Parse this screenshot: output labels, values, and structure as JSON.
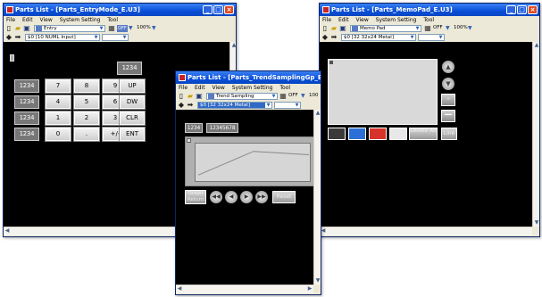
{
  "window_left": {
    "title": "Parts List - [Parts_EntryMode_E.U3]",
    "menu": [
      "File",
      "Edit",
      "View",
      "System Setting",
      "Tool"
    ],
    "toolbar": {
      "part_select": "Entry",
      "toggle": "OFF",
      "zoom": "100%"
    },
    "address_field": "$0 [10 NUML Input]",
    "display_label": "1234",
    "readouts": [
      "1234",
      "1234",
      "1234",
      "1234"
    ],
    "keys": [
      "7",
      "8",
      "9",
      "UP",
      "4",
      "5",
      "6",
      "DW",
      "1",
      "2",
      "3",
      "CLR",
      "0",
      ".",
      "+/-",
      "ENT"
    ]
  },
  "window_middle": {
    "title": "Parts List - [Parts_TrendSamplingGp_E.U3]",
    "menu": [
      "File",
      "Edit",
      "View",
      "System Setting",
      "Tool"
    ],
    "toolbar": {
      "part_select": "Trend Sampling",
      "toggle": "OFF",
      "zoom": "100"
    },
    "address_field": "$0 [32 32x24 Metal]",
    "readout_short": "1234",
    "readout_long": "12345678",
    "chart_data": {
      "type": "line",
      "x": [
        0,
        1,
        2
      ],
      "values": [
        0.15,
        0.85,
        0.75
      ]
    },
    "buttons": {
      "graph_return": "Graph Return",
      "reset": "Reset"
    }
  },
  "window_right": {
    "title": "Parts List - [Parts_MemoPad_E.U3]",
    "menu": [
      "File",
      "Edit",
      "View",
      "System Setting",
      "Tool"
    ],
    "toolbar": {
      "part_select": "Memo Pad",
      "toggle": "OFF",
      "zoom": "100%"
    },
    "address_field": "$0 [32 32x24 Metal]",
    "colors": [
      "#3a3a3a",
      "#2c6fd6",
      "#d6332b",
      "#e8e8e8"
    ],
    "buttons": {
      "delete_all": "Delete All",
      "line": "Line"
    }
  }
}
